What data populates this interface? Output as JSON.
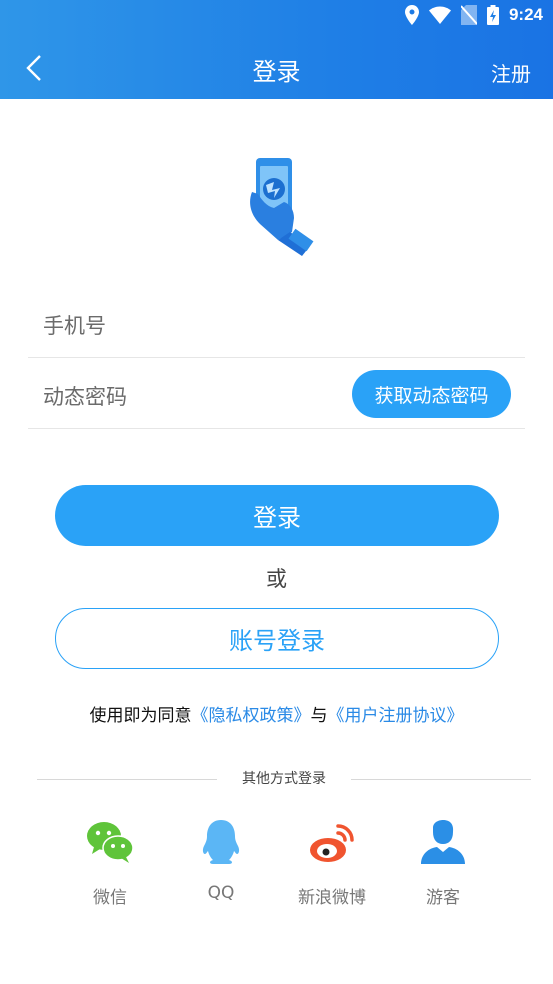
{
  "status": {
    "time": "9:24"
  },
  "nav": {
    "title": "登录",
    "register": "注册"
  },
  "form": {
    "phone_label": "手机号",
    "code_label": "动态密码",
    "get_code_button": "获取动态密码"
  },
  "login_button": "登录",
  "or_text": "或",
  "account_login_button": "账号登录",
  "agreement": {
    "prefix": "使用即为同意",
    "privacy_link": "《隐私权政策》",
    "and": "与",
    "terms_link": "《用户注册协议》"
  },
  "other_login": {
    "title": "其他方式登录",
    "options": [
      {
        "label": "微信",
        "icon": "wechat-icon",
        "color": "#5fc43a"
      },
      {
        "label": "QQ",
        "icon": "qq-icon",
        "color": "#5bb6f5"
      },
      {
        "label": "新浪微博",
        "icon": "weibo-icon",
        "color": "#f0542f"
      },
      {
        "label": "游客",
        "icon": "guest-icon",
        "color": "#2b8fe6"
      }
    ]
  },
  "colors": {
    "header": "#1f7fe6",
    "accent": "#2aa2f7",
    "link": "#2a8ae6"
  }
}
